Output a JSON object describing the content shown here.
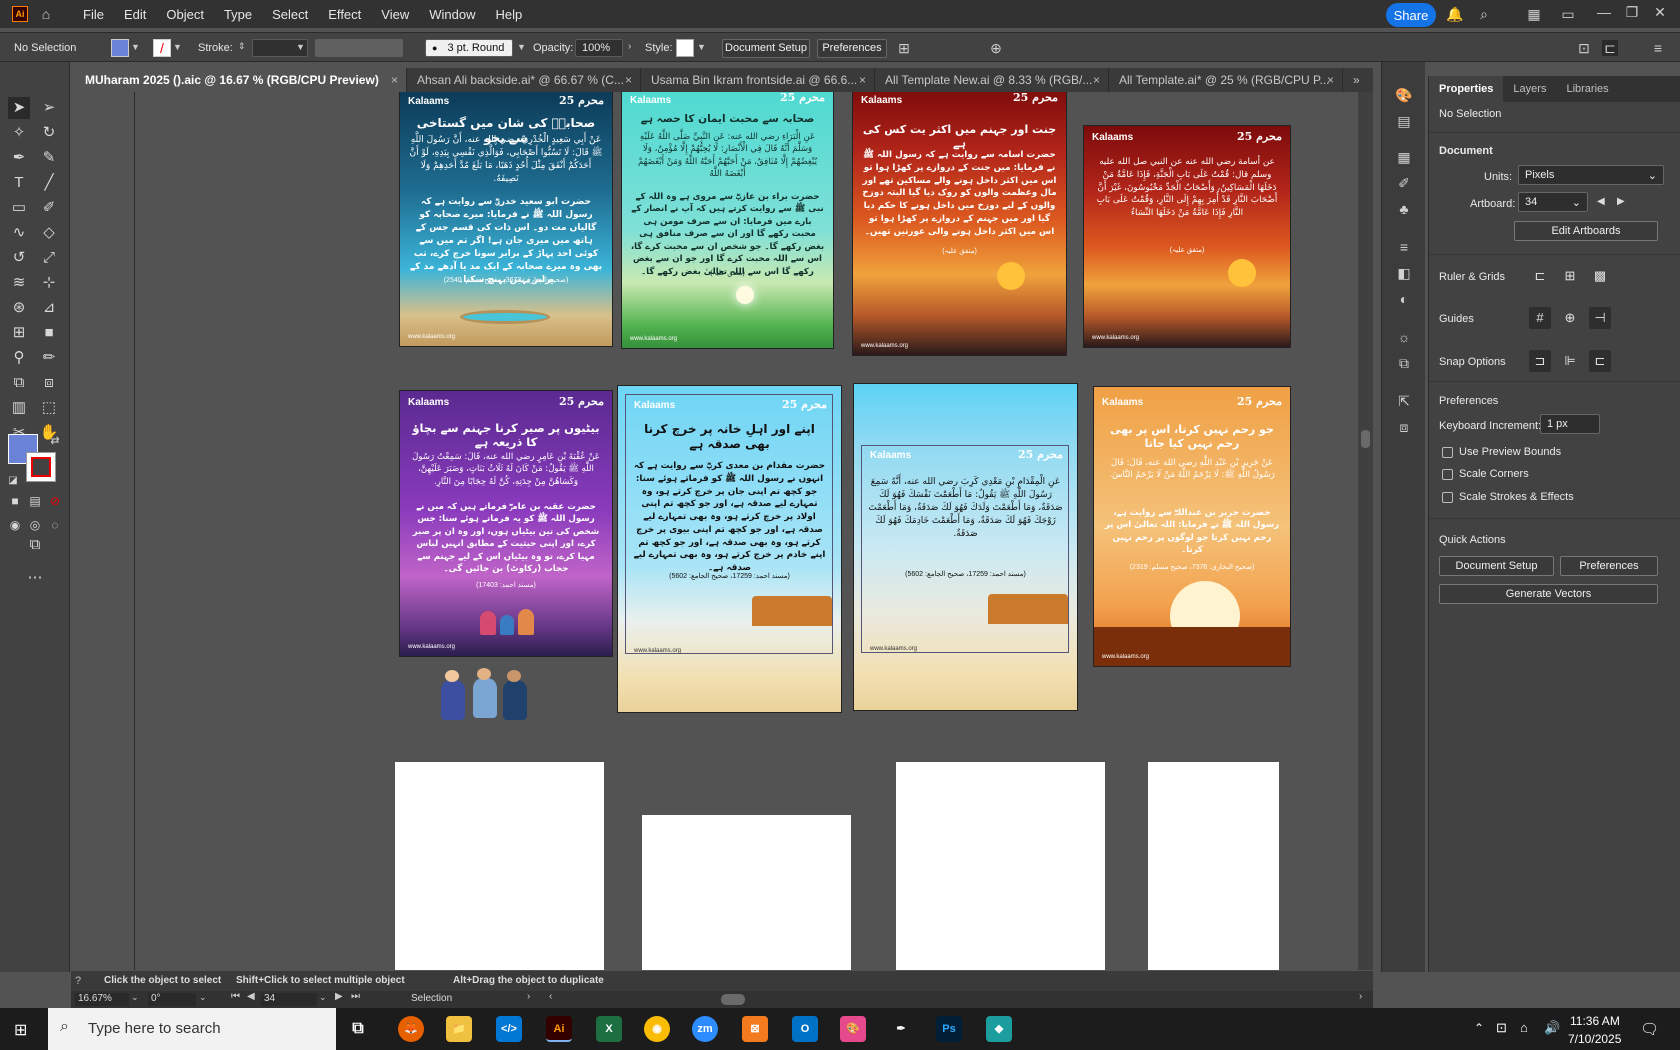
{
  "menubar": {
    "app_logo": "Ai",
    "items": [
      "File",
      "Edit",
      "Object",
      "Type",
      "Select",
      "Effect",
      "View",
      "Window",
      "Help"
    ],
    "share_label": "Share"
  },
  "controlbar": {
    "selection": "No Selection",
    "stroke_label": "Stroke:",
    "brush": "3 pt. Round",
    "opacity_label": "Opacity:",
    "opacity_value": "100%",
    "style_label": "Style:",
    "document_setup": "Document Setup",
    "preferences": "Preferences"
  },
  "tabs": [
    {
      "label": "MUharam 2025 ().aic @ 16.67 % (RGB/CPU Preview)",
      "active": true
    },
    {
      "label": "Ahsan Ali backside.ai* @ 66.67 % (C...",
      "active": false
    },
    {
      "label": "Usama Bin Ikram frontside.ai @ 66.6...",
      "active": false
    },
    {
      "label": "All Template New.ai @ 8.33 % (RGB/...",
      "active": false
    },
    {
      "label": "All Template.ai* @ 25 % (RGB/CPU P...",
      "active": false
    }
  ],
  "artboards": [
    {
      "brand": "Kalaams",
      "badge": "محرم 25",
      "title": "صحابہؓ کی شان میں گستاخی سے بچو",
      "arabic": "عَنْ أَبِي سَعِيدٍ الْخُدْرِيِّ رضي الله عنه، أَنَّ رَسُولَ اللَّهِ ﷺ قَالَ: لَا تَسُبُّوا أَصْحَابِي، فَوَالَّذِي نَفْسِي بِيَدِهِ، لَوْ أَنَّ أَحَدَكُمْ أَنْفَقَ مِثْلَ أُحُدٍ ذَهَبًا، مَا بَلَغَ مُدَّ أَحَدِهِمْ وَلَا نَصِيفَهُ.",
      "urdu": "حضرت ابو سعید خدریؓ سے روایت ہے کہ رسول اللہ ﷺ نے فرمایا: میرے صحابہ کو گالیاں مت دو۔ اس ذات کی قسم جس کے ہاتھ میں میری جان ہے! اگر تم میں سے کوئی احد پہاڑ کے برابر سونا خرچ کرے، تب بھی وہ میرے صحابہ کے ایک مد یا آدھے مد کے برابر نہیں پہنچ سکتا۔",
      "ref": "(صحیح البخاری: 3673، صحیح مسلم: 2540)",
      "url": "www.kalaams.org"
    },
    {
      "brand": "Kalaams",
      "badge": "محرم 25",
      "title": "صحابہ سے محبت ایمان کا حصہ ہے",
      "arabic": "عَنِ الْبَرَاءِ رضي الله عنه: عَنِ النَّبِيِّ صَلَّى اللَّهُ عَلَيْهِ وَسَلَّمَ أَنَّهُ قَالَ فِي الْأَنْصَارِ: لَا يُحِبُّهُمْ إِلَّا مُؤْمِنٌ، وَلَا يُبْغِضُهُمْ إِلَّا مُنَافِقٌ، مَنْ أَحَبَّهُمْ أَحَبَّهُ اللَّهُ وَمَنْ أَبْغَضَهُمْ أَبْغَضَهُ اللَّهُ",
      "urdu": "حضرت براء بن عازبؓ سے مروی ہے وہ اللہ کے نبی ﷺ سے روایت کرتے ہیں کہ آپ نے انصار کے بارے میں فرمایا: ان سے صرف مومن ہی محبت رکھے گا اور ان سے صرف منافق ہی بغض رکھے گا۔ جو شخص ان سے محبت کرے گا، اس سے اللہ محبت کرے گا اور جو ان سے بغض رکھے گا اس سے اللہ تعالیٰ بغض رکھے گا۔",
      "ref": "(متفق علیہ)",
      "url": "www.kalaams.org"
    },
    {
      "brand": "Kalaams",
      "badge": "محرم 25",
      "title": "جنت اور جہنم میں اکثر یت کس کی ہے",
      "urdu": "حضرت اسامہ سے روایت ہے کہ رسول اللہ ﷺ نے فرمایا: میں جنت کے دروازے پر کھڑا ہوا تو اس میں اکثر داخل ہونے والے مساکین تھے اور مال وعظمت والوں کو روک دیا گیا البتہ دوزخ والوں کے لیے دوزخ میں داخل ہونے کا حکم دیا گیا اور میں جہنم کے دروازے پر کھڑا ہوا تو اس میں اکثر داخل ہونے والی عورتیں تھیں۔",
      "ref": "(متفق علیہ)",
      "url": "www.kalaams.org"
    },
    {
      "brand": "Kalaams",
      "badge": "محرم 25",
      "arabic": "عن أسامة رضي الله عنه عن النبي صل الله عليه وسلم قال: قُمْتُ عَلَى بَابِ الْجَنَّةِ، فَإِذَا عَامَّةُ مَنْ دَخَلَهَا الْمَسَاكِينُ، وَأَصْحَابُ الْجَدِّ مَحْبُوسُونَ، غَيْرَ أَنَّ أَصْحَابَ النَّارِ قَدْ أُمِرَ بِهِمْ إِلَى النَّارِ، وَقُمْتُ عَلَى بَابِ النَّارِ فَإِذَا عَامَّةُ مَنْ دَخَلَهَا النِّسَاءُ",
      "ref": "(متفق علیہ)",
      "url": "www.kalaams.org"
    },
    {
      "brand": "Kalaams",
      "badge": "محرم 25",
      "title": "بیٹیوں پر صبر کرنا جہنم سے بچاؤ کا ذریعہ ہے",
      "arabic": "عَنْ عُقْبَةَ بْنِ عَامِرٍ رضي الله عنه، قَالَ: سَمِعْتُ رَسُولَ اللَّهِ ﷺ يَقُولُ: مَنْ كَانَ لَهُ ثَلَاثُ بَنَاتٍ، وَصَبَرَ عَلَيْهِنَّ، وَكَسَاهُنَّ مِنْ جِدَتِهِ، كُنَّ لَهُ حِجَابًا مِنَ النَّارِ.",
      "urdu": "حضرت عقبہ بن عامرؓ فرماتے ہیں کہ میں نے رسول اللہ ﷺ کو یہ فرماتے ہوئے سنا: جس شخص کی تین بیٹیاں ہوں، اور وہ ان پر صبر کرے، اور اپنی حیثیت کے مطابق انہیں لباس مہیا کرے، تو وہ بیٹیاں اس کے لیے جہنم سے حجاب (رکاوٹ) بن جائیں گی۔",
      "ref": "(مسند احمد: 17403)",
      "url": "www.kalaams.org"
    },
    {
      "brand": "Kalaams",
      "badge": "محرم 25",
      "title": "اپنے اور اہلِ خانہ پر خرچ کرنا بھی صدقہ ہے",
      "urdu": "حضرت مقدام بن معدی کربؓ سے روایت ہے کہ انہوں نے رسول اللہ ﷺ کو فرماتے ہوئے سنا: جو کچھ تم اپنی جان پر خرچ کرتے ہو، وہ تمہارے لیے صدقہ ہے، اور جو کچھ تم اپنی اولاد پر خرچ کرتے ہو، وہ بھی تمہارے لیے صدقہ ہے، اور جو کچھ تم اپنی بیوی پر خرچ کرتے ہو، وہ بھی صدقہ ہے، اور جو کچھ تم اپنے خادم پر خرچ کرتے ہو، وہ بھی تمہارے لیے صدقہ ہے۔",
      "ref": "(مسند احمد: 17259، صحیح الجامع: 5602)",
      "url": "www.kalaams.org"
    },
    {
      "brand": "Kalaams",
      "badge": "محرم 25",
      "arabic": "عَنِ الْمِقْدَامِ بْنِ مَعْدِي كَرِبَ رضي الله عنه، أَنَّهُ سَمِعَ رَسُولَ اللَّهِ ﷺ يَقُولُ: مَا أَطْعَمْتَ نَفْسَكَ فَهُوَ لَكَ صَدَقَةٌ، وَمَا أَطْعَمْتَ وَلَدَكَ فَهُوَ لَكَ صَدَقَةٌ، وَمَا أَطْعَمْتَ زَوْجَكَ فَهُوَ لَكَ صَدَقَةٌ، وَمَا أَطْعَمْتَ خَادِمَكَ فَهُوَ لَكَ صَدَقَةٌ.",
      "ref": "(مسند احمد: 17259، صحیح الجامع: 5602)",
      "url": "www.kalaams.org"
    },
    {
      "brand": "Kalaams",
      "badge": "محرم 25",
      "title": "جو رحم نہیں کرتا، اس پر بھی رحم نہیں کیا جاتا",
      "arabic": "عَنْ جَرِيرِ بْنِ عَبْدِ اللَّهِ رضي الله عنه، قَالَ: قَالَ رَسُولُ اللَّهِ ﷺ: لَا يَرْحَمُ اللَّهُ مَنْ لَا يَرْحَمُ النَّاسَ.",
      "urdu": "حضرت جریر بن عبداللہؓ سے روایت ہے، رسول اللہ ﷺ نے فرمایا: اللہ تعالیٰ اس پر رحم نہیں کرتا جو لوگوں پر رحم نہیں کرتا۔",
      "ref": "(صحیح البخاری: 7376، صحیح مسلم: 2319)",
      "url": "www.kalaams.org"
    }
  ],
  "properties": {
    "tabs": [
      "Properties",
      "Layers",
      "Libraries"
    ],
    "no_selection": "No Selection",
    "document_header": "Document",
    "units_label": "Units:",
    "units_value": "Pixels",
    "artboard_label": "Artboard:",
    "artboard_value": "34",
    "edit_artboards": "Edit Artboards",
    "ruler_grids": "Ruler & Grids",
    "guides": "Guides",
    "snap_options": "Snap Options",
    "preferences_header": "Preferences",
    "keyboard_increment_label": "Keyboard Increment:",
    "keyboard_increment_value": "1 px",
    "checkboxes": [
      "Use Preview Bounds",
      "Scale Corners",
      "Scale Strokes & Effects"
    ],
    "quick_actions": "Quick Actions",
    "document_setup": "Document Setup",
    "preferences": "Preferences",
    "generate_vectors": "Generate Vectors"
  },
  "status": {
    "hint_click": "Click the object to select",
    "hint_shift": "Shift+Click to select multiple object",
    "hint_alt": "Alt+Drag the object to duplicate",
    "zoom": "16.67%",
    "rotation": "0°",
    "artboard_nav": "34",
    "tool": "Selection"
  },
  "taskbar": {
    "search_placeholder": "Type here to search",
    "time": "11:36 AM",
    "date": "7/10/2025"
  },
  "colors": {
    "accent": "#1473e6",
    "illustrator": "#ff9a00"
  }
}
